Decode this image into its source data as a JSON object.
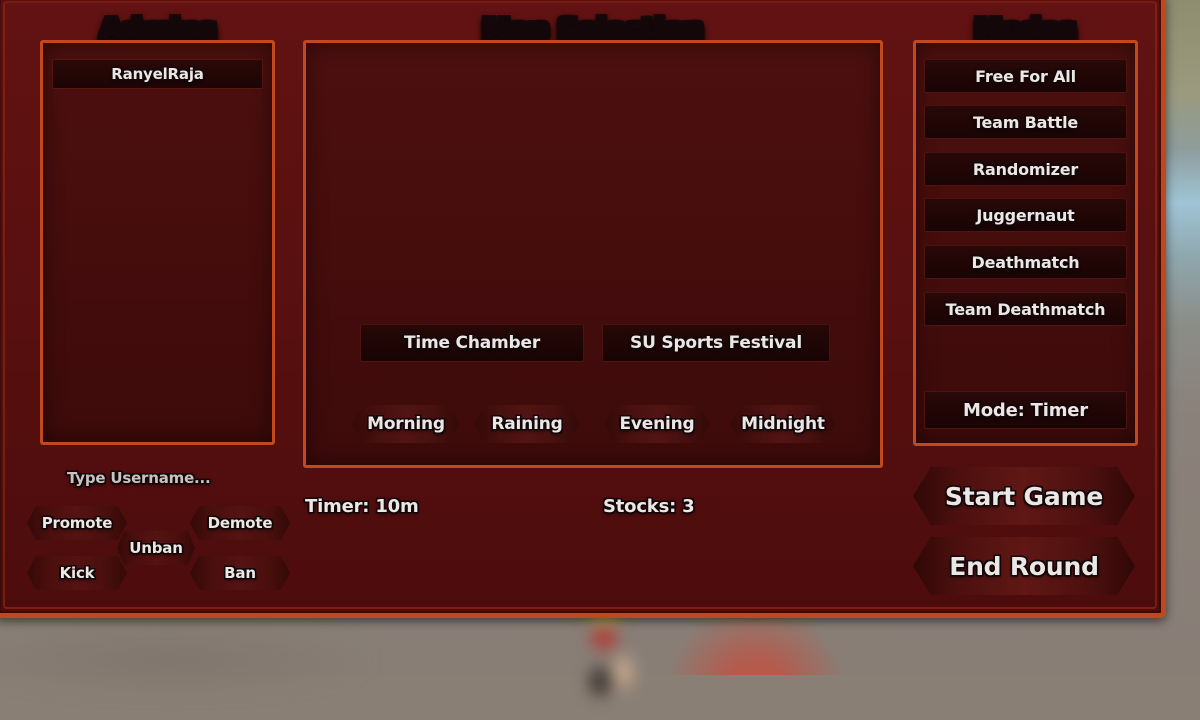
{
  "panels": {
    "admins": {
      "title": "Admins",
      "entries": [
        "RanyelRaja"
      ],
      "username_placeholder": "Type Username...",
      "actions": [
        {
          "id": "promote",
          "label": "Promote"
        },
        {
          "id": "demote",
          "label": "Demote"
        },
        {
          "id": "unban",
          "label": "Unban"
        },
        {
          "id": "kick",
          "label": "Kick"
        },
        {
          "id": "ban",
          "label": "Ban"
        }
      ]
    },
    "map_selection": {
      "title": "Map Selection",
      "maps": [
        {
          "id": "time-chamber",
          "label": "Time Chamber"
        },
        {
          "id": "su-sports-festival",
          "label": "SU Sports Festival"
        }
      ],
      "times_of_day": [
        {
          "id": "morning",
          "label": "Morning"
        },
        {
          "id": "raining",
          "label": "Raining"
        },
        {
          "id": "evening",
          "label": "Evening"
        },
        {
          "id": "midnight",
          "label": "Midnight"
        }
      ],
      "timer_label": "Timer: 10m",
      "stocks_label": "Stocks: 3"
    },
    "modes": {
      "title": "Modes",
      "items": [
        {
          "id": "free-for-all",
          "label": "Free For All"
        },
        {
          "id": "team-battle",
          "label": "Team Battle"
        },
        {
          "id": "randomizer",
          "label": "Randomizer"
        },
        {
          "id": "juggernaut",
          "label": "Juggernaut"
        },
        {
          "id": "deathmatch",
          "label": "Deathmatch"
        },
        {
          "id": "team-deathmatch",
          "label": "Team Deathmatch"
        }
      ],
      "mode_toggle_label": "Mode: Timer"
    },
    "actions": {
      "start_game_label": "Start Game",
      "end_round_label": "End Round"
    }
  },
  "colors": {
    "frame_border": "#c0481c",
    "panel_background": "#5a1010",
    "subpanel_background": "#460d0d",
    "button_background": "#200605",
    "text": "#ebe7e4"
  }
}
